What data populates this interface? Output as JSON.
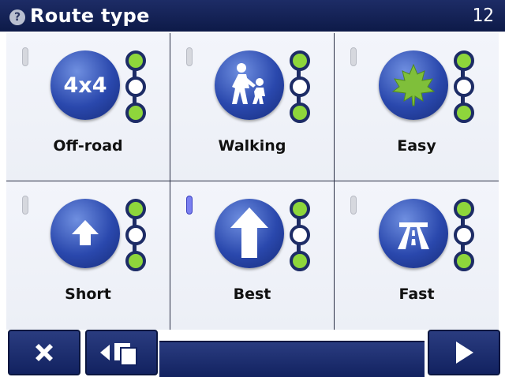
{
  "header": {
    "help_icon": "?",
    "title": "Route type",
    "clock": "12"
  },
  "tiles": [
    {
      "label": "Off-road",
      "icon": "four-by-four-icon",
      "icon_text": "4x4",
      "indicator_active": false
    },
    {
      "label": "Walking",
      "icon": "pedestrian-icon",
      "indicator_active": false
    },
    {
      "label": "Easy",
      "icon": "maple-leaf-icon",
      "indicator_active": false
    },
    {
      "label": "Short",
      "icon": "short-arrow-icon",
      "indicator_active": false
    },
    {
      "label": "Best",
      "icon": "best-arrow-icon",
      "indicator_active": true
    },
    {
      "label": "Fast",
      "icon": "highway-icon",
      "indicator_active": false
    }
  ],
  "colors": {
    "title_bar": "#1d2c66",
    "icon_blue": "#2a48ad",
    "dot_green": "#8ed63b",
    "active_indicator": "#7a7ff0"
  },
  "footer": {
    "close_icon": "close-icon",
    "back_icon": "back-pages-icon",
    "next_icon": "next-arrow-icon"
  }
}
